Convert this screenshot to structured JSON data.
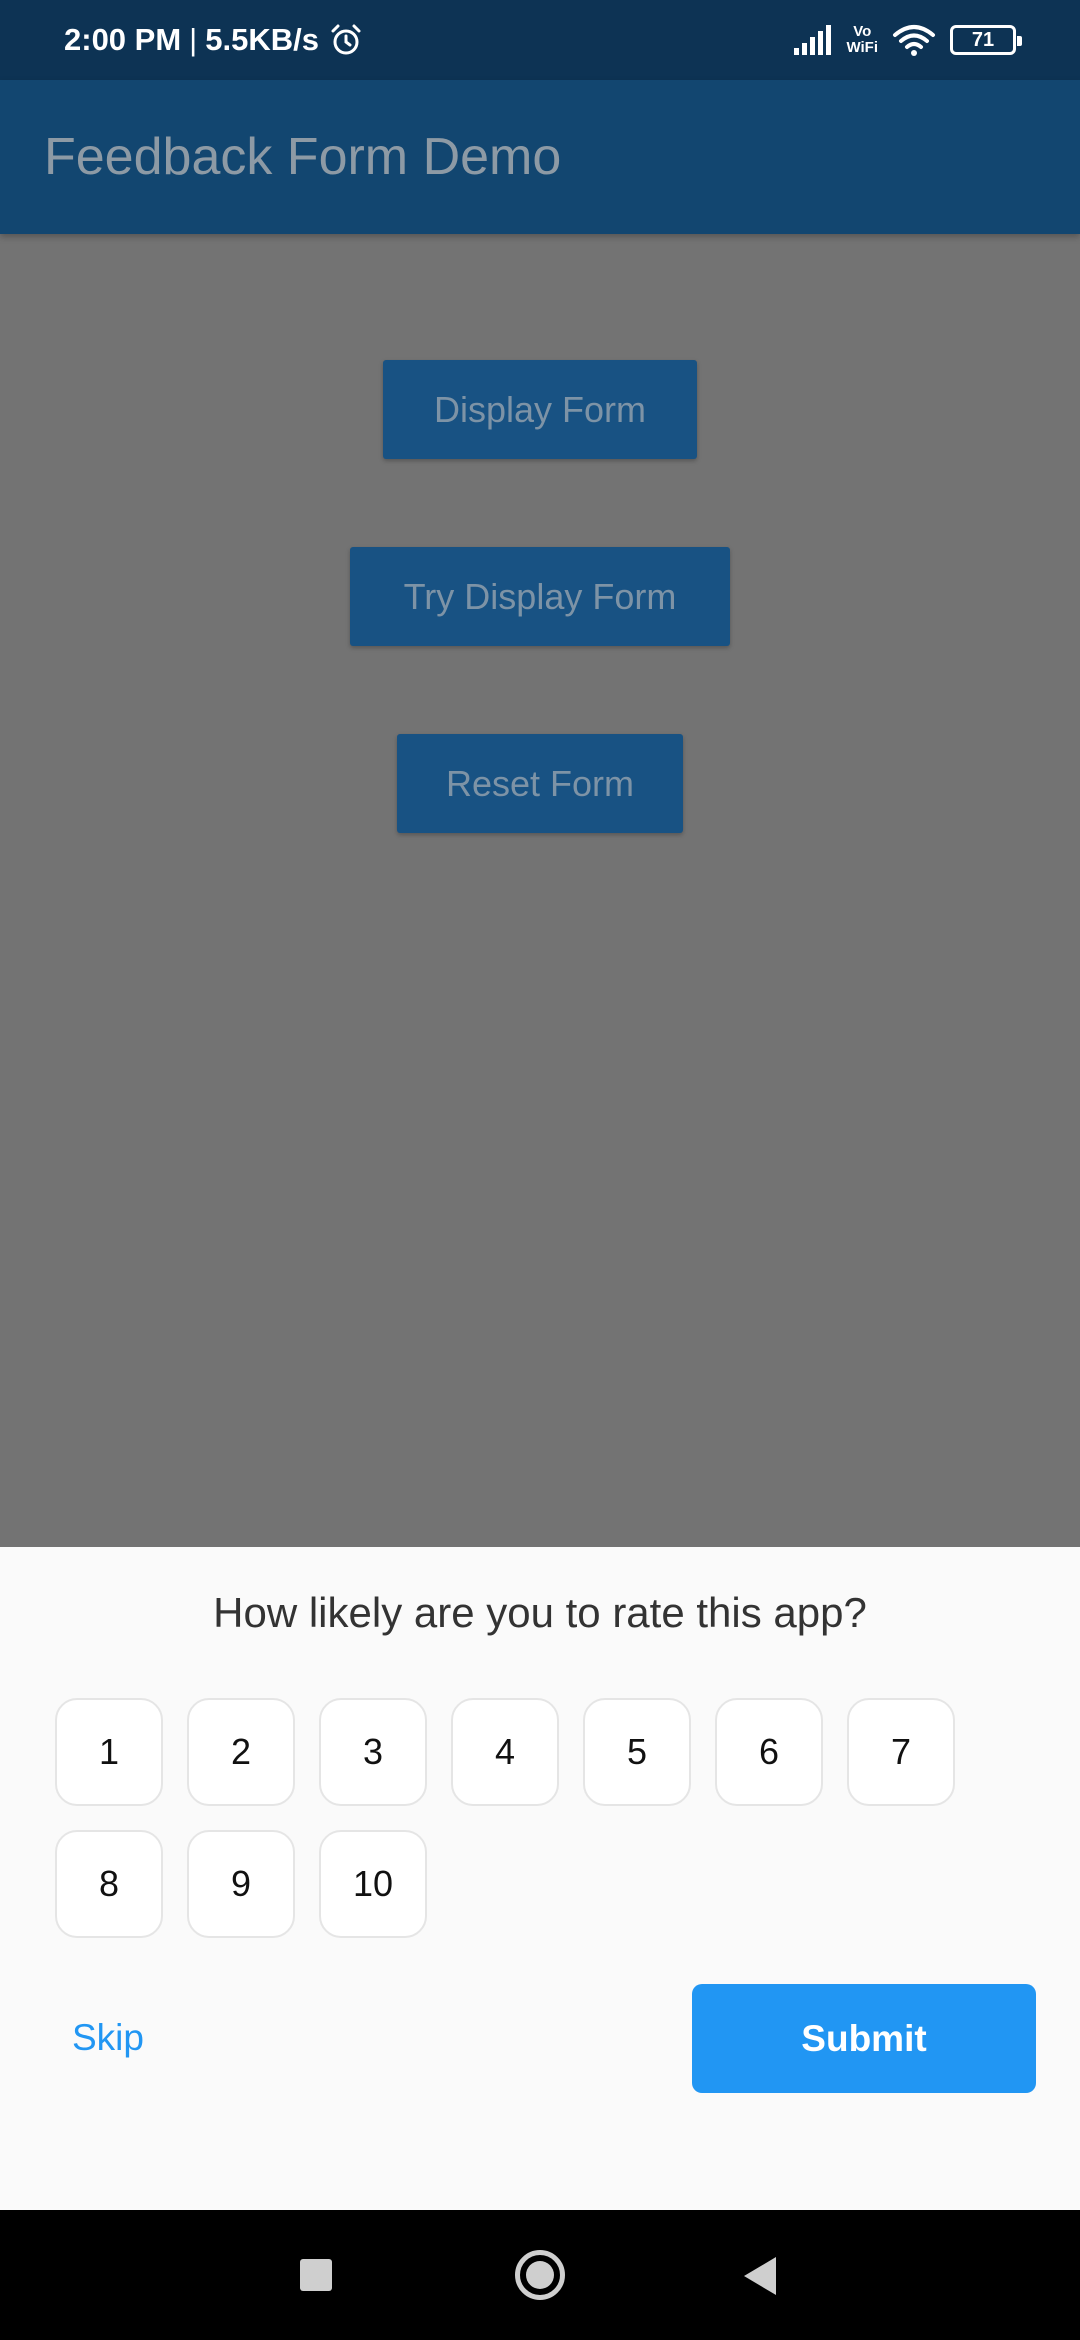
{
  "status_bar": {
    "time": "2:00 PM",
    "separator": "|",
    "speed": "5.5KB/s",
    "vowifi_top": "Vo",
    "vowifi_bottom": "WiFi",
    "battery": "71",
    "icons": [
      "alarm-icon",
      "signal-icon",
      "wifi-icon",
      "battery-icon"
    ]
  },
  "app_bar": {
    "title": "Feedback Form Demo"
  },
  "main": {
    "buttons": {
      "display_form": "Display Form",
      "try_display_form": "Try Display Form",
      "reset_form": "Reset Form"
    }
  },
  "sheet": {
    "question": "How likely are you to rate this app?",
    "options": [
      "1",
      "2",
      "3",
      "4",
      "5",
      "6",
      "7",
      "8",
      "9",
      "10"
    ],
    "skip_label": "Skip",
    "submit_label": "Submit"
  },
  "nav_bar": {
    "icons": [
      "recents-icon",
      "home-icon",
      "back-icon"
    ]
  },
  "colors": {
    "status_bar": "#0d3354",
    "app_bar": "#124670",
    "scrim": "#737373",
    "accent": "#2196f3",
    "sheet_bg": "#fafafa"
  }
}
